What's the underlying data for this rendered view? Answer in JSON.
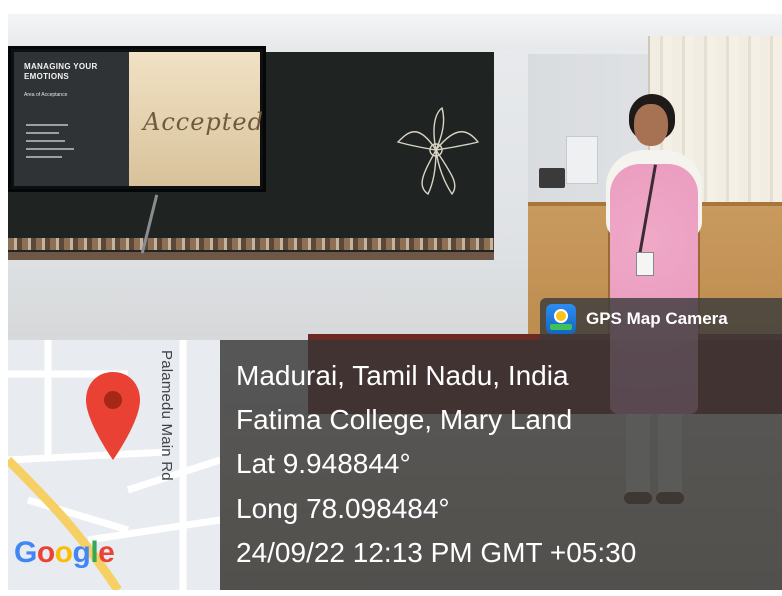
{
  "slide": {
    "title": "MANAGING YOUR EMOTIONS",
    "subtitle": "Area of Acceptance",
    "sand_word": "Accepted"
  },
  "overlay": {
    "app_name": "GPS Map Camera",
    "app_icon": "gps-map-camera-icon",
    "location": "Madurai, Tamil Nadu, India",
    "address": "Fatima College, Mary Land",
    "latitude": "Lat 9.948844°",
    "longitude": "Long 78.098484°",
    "timestamp": "24/09/22 12:13 PM GMT +05:30"
  },
  "map": {
    "road_label": "Palamedu Main Rd",
    "pin_icon": "map-pin-icon",
    "logo": [
      "G",
      "o",
      "o",
      "g",
      "l",
      "e"
    ],
    "colors": {
      "pin": "#e94235",
      "pin_dot": "#a52714",
      "major_road": "#f6cf65"
    }
  }
}
